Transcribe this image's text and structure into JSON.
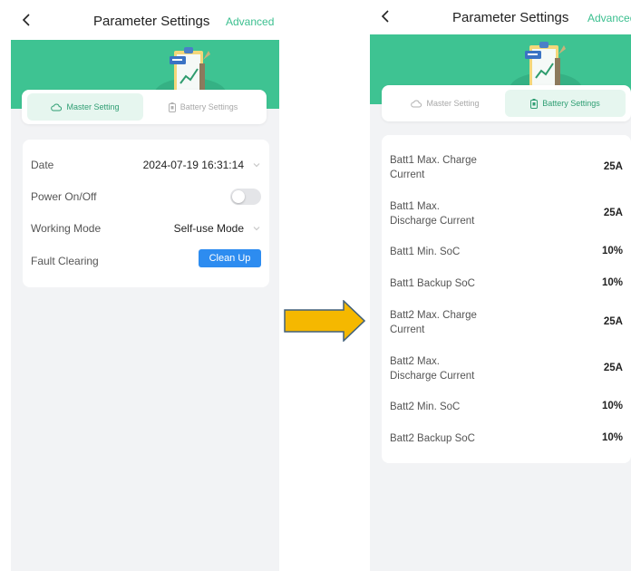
{
  "left_screen": {
    "nav": {
      "title": "Parameter Settings",
      "advanced": "Advanced"
    },
    "tabs": [
      {
        "label": "Master Setting",
        "active": true
      },
      {
        "label": "Battery Settings",
        "active": false
      }
    ],
    "rows": {
      "date": {
        "label": "Date",
        "value": "2024-07-19 16:31:14"
      },
      "power": {
        "label": "Power On/Off",
        "state": "off"
      },
      "mode": {
        "label": "Working Mode",
        "value": "Self-use Mode"
      },
      "fault": {
        "label": "Fault Clearing",
        "button": "Clean Up"
      }
    }
  },
  "right_screen": {
    "nav": {
      "title": "Parameter Settings",
      "advanced": "Advanced"
    },
    "tabs": [
      {
        "label": "Master Setting",
        "active": false
      },
      {
        "label": "Battery Settings",
        "active": true
      }
    ],
    "battery_rows": [
      {
        "label_line1": "Batt1 Max. Charge",
        "label_line2": "Current",
        "value": "25A"
      },
      {
        "label_line1": "Batt1 Max.",
        "label_line2": "Discharge Current",
        "value": "25A"
      },
      {
        "label_line1": "Batt1 Min. SoC",
        "label_line2": "",
        "value": "10%"
      },
      {
        "label_line1": "Batt1 Backup SoC",
        "label_line2": "",
        "value": "10%"
      },
      {
        "label_line1": "Batt2 Max. Charge",
        "label_line2": "Current",
        "value": "25A"
      },
      {
        "label_line1": "Batt2 Max.",
        "label_line2": "Discharge Current",
        "value": "25A"
      },
      {
        "label_line1": "Batt2 Min. SoC",
        "label_line2": "",
        "value": "10%"
      },
      {
        "label_line1": "Batt2 Backup SoC",
        "label_line2": "",
        "value": "10%"
      }
    ]
  },
  "colors": {
    "brand_green": "#3ec392",
    "active_tab_bg": "#e6f6ef",
    "button_blue": "#2d8cf0",
    "arrow_fill": "#f5b800",
    "arrow_stroke": "#41617c"
  },
  "icons": [
    "back-arrow-icon",
    "cloud-icon",
    "battery-icon",
    "chevron-down-icon",
    "toggle-switch",
    "clipboard-chart-illustration",
    "transition-arrow"
  ]
}
